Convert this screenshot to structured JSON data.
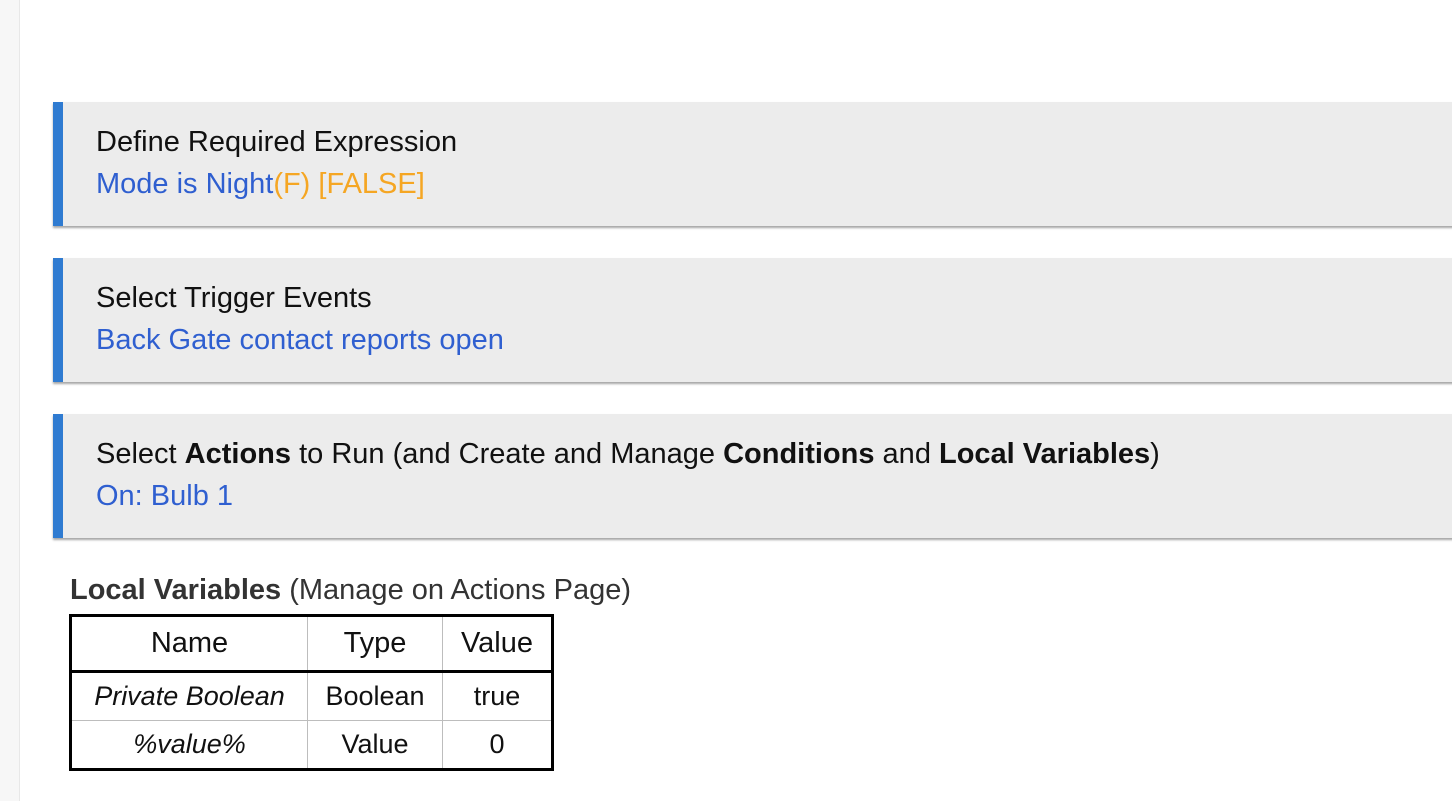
{
  "sections": [
    {
      "title": "Define Required Expression",
      "summary": {
        "text": "Mode is Night",
        "flag": "(F)",
        "state": "[FALSE]"
      }
    },
    {
      "title": "Select Trigger Events",
      "summary": {
        "text": "Back Gate contact reports open"
      }
    },
    {
      "title_parts": [
        "Select ",
        "Actions",
        " to Run (and Create and Manage ",
        "Conditions",
        " and ",
        "Local Variables",
        ")"
      ],
      "summary": {
        "text": "On: Bulb 1"
      }
    }
  ],
  "local_variables": {
    "heading_bold": "Local Variables",
    "heading_note": "(Manage on Actions Page)",
    "columns": [
      "Name",
      "Type",
      "Value"
    ],
    "rows": [
      {
        "name": "Private Boolean",
        "type": "Boolean",
        "value": "true"
      },
      {
        "name": "%value%",
        "type": "Value",
        "value": "0"
      }
    ]
  },
  "colors": {
    "accent": "#2f7bd1",
    "link": "#2f5fd0",
    "false_state": "#f5a623",
    "card_bg": "#ececec"
  }
}
